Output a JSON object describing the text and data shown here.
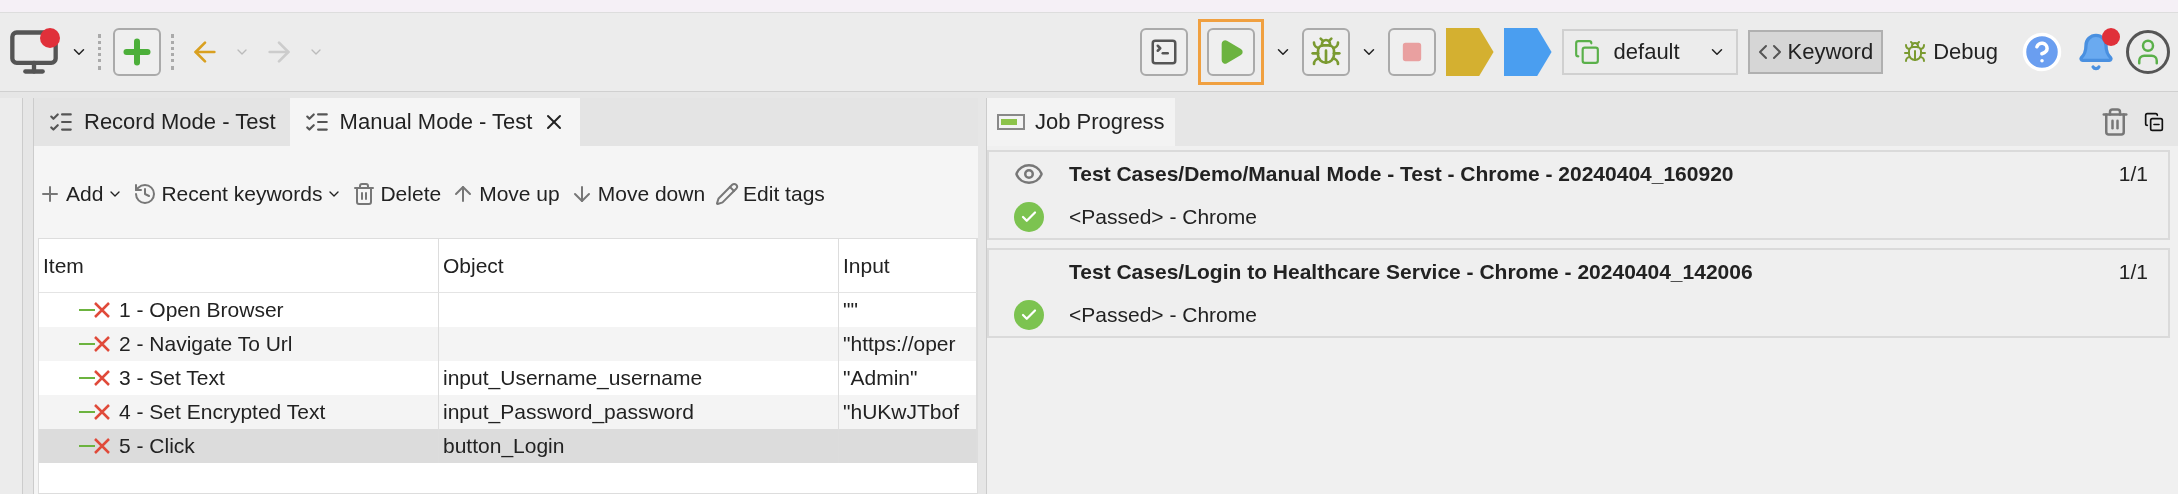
{
  "toolbar": {
    "navigation": [
      {
        "kind": "back",
        "disabled": false
      },
      {
        "kind": "forward",
        "disabled": true
      }
    ],
    "run_highlighted": true,
    "stop_disabled": true,
    "profile": "default",
    "modes": [
      {
        "kind": "keyword",
        "label": "Keyword",
        "selected": true
      },
      {
        "kind": "debug",
        "label": "Debug",
        "selected": false
      }
    ],
    "notifications_unread": true
  },
  "editor": {
    "tabs": [
      {
        "label": "Record Mode - Test",
        "selected": false
      },
      {
        "label": "Manual Mode - Test",
        "selected": true
      }
    ],
    "actions": [
      {
        "kind": "add",
        "label": "Add",
        "dropdown": true
      },
      {
        "kind": "recent",
        "label": "Recent keywords",
        "dropdown": true
      },
      {
        "kind": "delete",
        "label": "Delete",
        "dropdown": false
      },
      {
        "kind": "up",
        "label": "Move up",
        "dropdown": false
      },
      {
        "kind": "down",
        "label": "Move down",
        "dropdown": false
      },
      {
        "kind": "tags",
        "label": "Edit tags",
        "dropdown": false
      }
    ],
    "table": {
      "columns": [
        "Item",
        "Object",
        "Input"
      ],
      "rows": [
        {
          "item": "1 - Open Browser",
          "object": "",
          "input": "\"\"",
          "selected": false
        },
        {
          "item": "2 - Navigate To Url",
          "object": "",
          "input": "\"https://oper",
          "selected": false
        },
        {
          "item": "3 - Set Text",
          "object": "input_Username_username",
          "input": "\"Admin\"",
          "selected": false
        },
        {
          "item": "4 - Set Encrypted Text",
          "object": "input_Password_password",
          "input": "\"hUKwJTbof",
          "selected": false
        },
        {
          "item": "5 - Click",
          "object": "button_Login",
          "input": "",
          "selected": true
        }
      ]
    }
  },
  "job_progress": {
    "title": "Job Progress",
    "jobs": [
      {
        "title": "Test Cases/Demo/Manual Mode - Test - Chrome - 20240404_160920",
        "count": "1/1",
        "watched": true,
        "status": "<Passed> - Chrome",
        "passed": true
      },
      {
        "title": "Test Cases/Login to Healthcare Service - Chrome - 20240404_142006",
        "count": "1/1",
        "watched": false,
        "status": "<Passed> - Chrome",
        "passed": true
      }
    ]
  }
}
